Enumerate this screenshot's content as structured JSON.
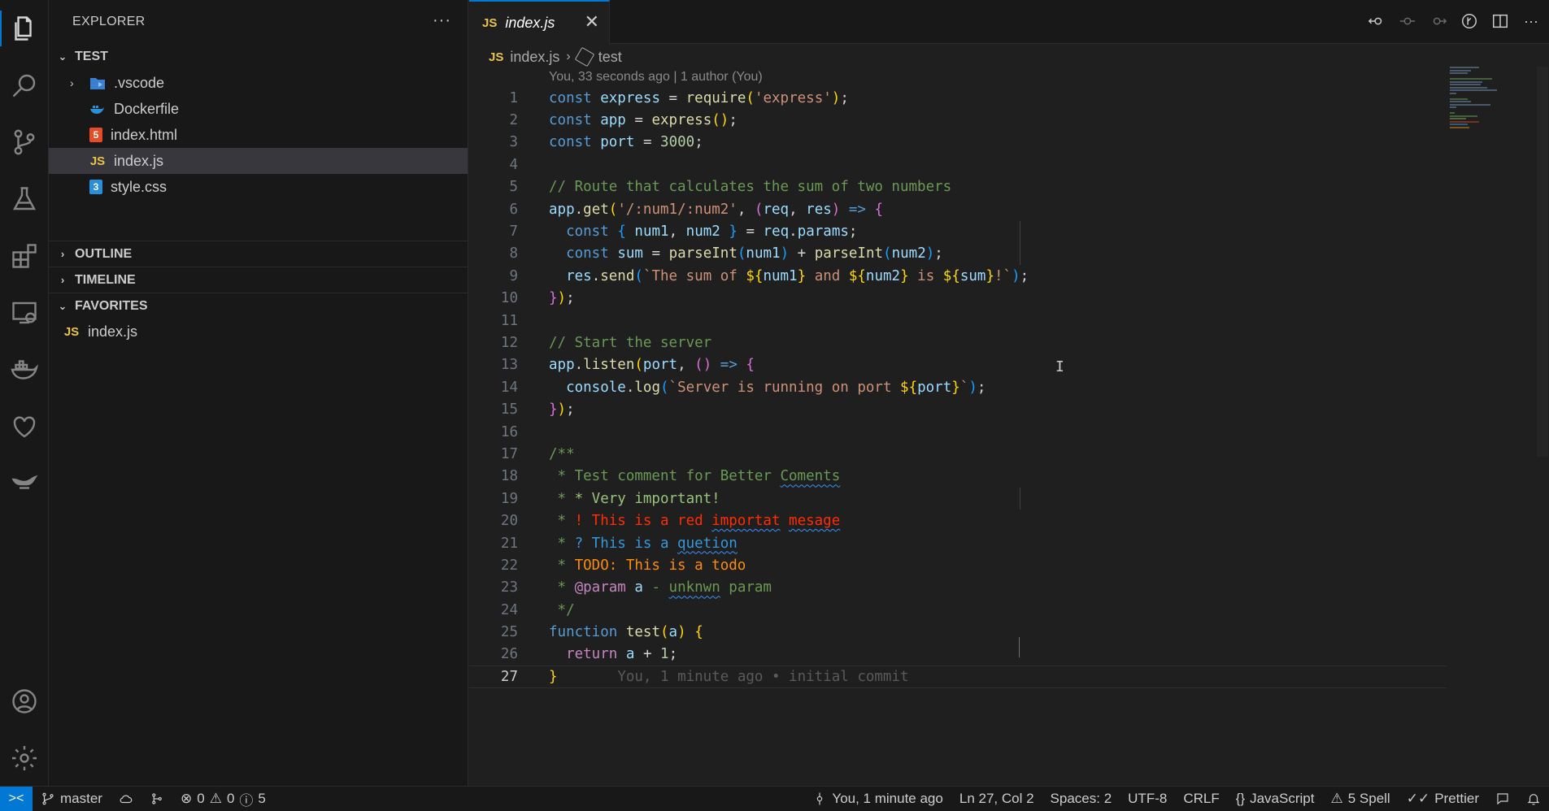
{
  "activity_bar": {
    "items": [
      {
        "name": "explorer-icon",
        "active": true
      },
      {
        "name": "search-icon"
      },
      {
        "name": "source-control-icon"
      },
      {
        "name": "testing-icon"
      },
      {
        "name": "extensions-icon"
      },
      {
        "name": "remote-explorer-icon"
      },
      {
        "name": "docker-icon"
      },
      {
        "name": "favorites-heart-icon"
      },
      {
        "name": "genie-lamp-icon"
      }
    ],
    "bottom": [
      {
        "name": "accounts-icon"
      },
      {
        "name": "manage-gear-icon"
      }
    ]
  },
  "sidebar": {
    "title": "EXPLORER",
    "more": "···",
    "folder": "TEST",
    "files": [
      {
        "label": ".vscode",
        "type": "folder"
      },
      {
        "label": "Dockerfile",
        "type": "docker"
      },
      {
        "label": "index.html",
        "type": "html"
      },
      {
        "label": "index.js",
        "type": "js",
        "selected": true
      },
      {
        "label": "style.css",
        "type": "css"
      }
    ],
    "outline": "OUTLINE",
    "timeline": "TIMELINE",
    "favorites": "FAVORITES",
    "favorites_items": [
      {
        "label": "index.js",
        "type": "js"
      }
    ],
    "js_badge": "JS",
    "html_badge": "5",
    "css_badge": "3"
  },
  "tabs": [
    {
      "label": "index.js",
      "badge": "JS",
      "close": "✕"
    }
  ],
  "breadcrumb": {
    "file": "index.js",
    "symbol": "test",
    "badge": "JS",
    "sep": "›"
  },
  "codelens": "You, 33 seconds ago | 1 author (You)",
  "editor": {
    "line_numbers": [
      "1",
      "2",
      "3",
      "4",
      "5",
      "6",
      "7",
      "8",
      "9",
      "10",
      "11",
      "12",
      "13",
      "14",
      "15",
      "16",
      "17",
      "18",
      "19",
      "20",
      "21",
      "22",
      "23",
      "24",
      "25",
      "26",
      "27"
    ],
    "current_line": 27,
    "blame": "You, 1 minute ago • initial commit"
  },
  "status": {
    "branch": "master",
    "errors": "0",
    "warnings": "0",
    "infos": "5",
    "blame": "You, 1 minute ago",
    "position": "Ln 27, Col 2",
    "spaces": "Spaces: 2",
    "encoding": "UTF-8",
    "eol": "CRLF",
    "language": "JavaScript",
    "spell": "5 Spell",
    "formatter": "Prettier"
  },
  "colors": {
    "accent": "#0078d4",
    "background": "#1f1f1f",
    "sidebar": "#181818"
  }
}
